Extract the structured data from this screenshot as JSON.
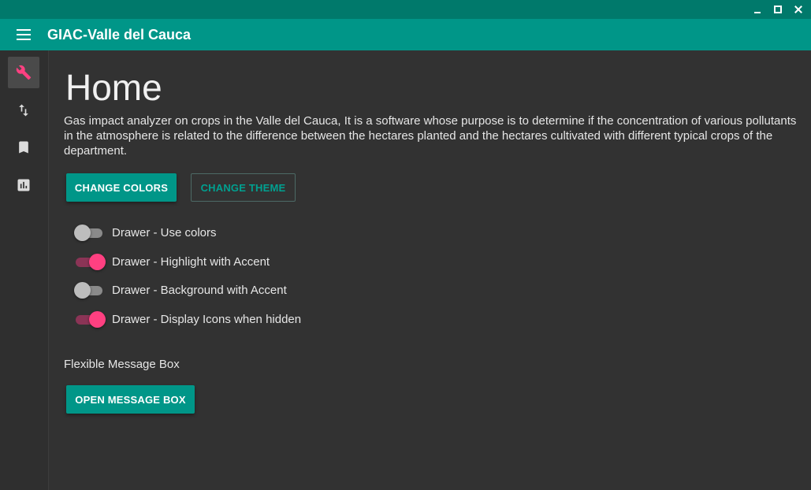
{
  "app": {
    "title": "GIAC-Valle del Cauca"
  },
  "sidebar": {
    "items": [
      {
        "icon": "wrench-icon",
        "active": true
      },
      {
        "icon": "swap-vertical-icon",
        "active": false
      },
      {
        "icon": "bookmark-icon",
        "active": false
      },
      {
        "icon": "chart-icon",
        "active": false
      }
    ]
  },
  "home": {
    "title": "Home",
    "description": "Gas impact analyzer on crops in the Valle del Cauca, It is a software whose purpose is to determine if the concentration of various pollutants in the atmosphere is related to the difference between the hectares planted and the hectares cultivated with different typical crops of the department.",
    "change_colors_label": "CHANGE COLORS",
    "change_theme_label": "CHANGE THEME",
    "toggles": [
      {
        "label": "Drawer - Use colors",
        "on": false
      },
      {
        "label": "Drawer - Highlight with Accent",
        "on": true
      },
      {
        "label": "Drawer - Background with Accent",
        "on": false
      },
      {
        "label": "Drawer - Display Icons when hidden",
        "on": true
      }
    ],
    "message_section_label": "Flexible Message Box",
    "open_message_box_label": "OPEN MESSAGE BOX"
  },
  "colors": {
    "primary": "#009688",
    "primary_dark": "#00796b",
    "accent": "#ff4081",
    "background": "#323232"
  }
}
